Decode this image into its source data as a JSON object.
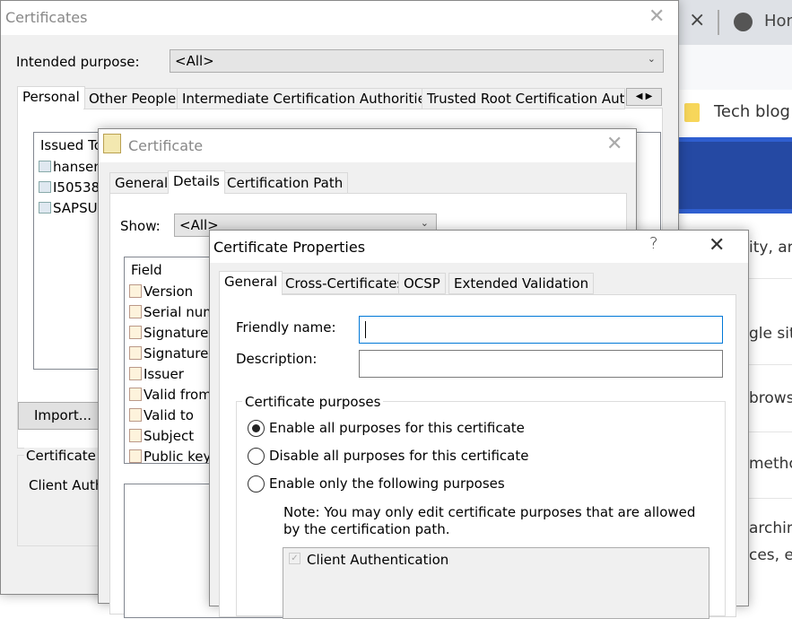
{
  "browser": {
    "tab_close": "×",
    "tab_title": "Hon",
    "bookmark": "Tech blog",
    "fragments": [
      "ity, an",
      "gle sit",
      "browsi",
      "metho",
      "archin",
      "ces, ev"
    ],
    "accent": "#2549a3"
  },
  "certificates": {
    "title": "Certificates",
    "close": "✕",
    "intended_purpose_label": "Intended purpose:",
    "intended_purpose_value": "<All>",
    "tabs": [
      "Personal",
      "Other People",
      "Intermediate Certification Authorities",
      "Trusted Root Certification Auth"
    ],
    "list_header": "Issued To",
    "rows": [
      "hansen",
      "I50538",
      "SAPSU"
    ],
    "import_button": "Import...",
    "group_label": "Certificate in",
    "group_value": "Client Auth"
  },
  "certificate": {
    "title": "Certificate",
    "close": "✕",
    "tabs": [
      "General",
      "Details",
      "Certification Path"
    ],
    "show_label": "Show:",
    "show_value": "<All>",
    "field_header": "Field",
    "fields": [
      "Version",
      "Serial num",
      "Signature",
      "Signature",
      "Issuer",
      "Valid from",
      "Valid to",
      "Subject",
      "Public key"
    ]
  },
  "properties": {
    "title": "Certificate Properties",
    "help": "?",
    "close": "✕",
    "tabs": [
      "General",
      "Cross-Certificates",
      "OCSP",
      "Extended Validation"
    ],
    "friendly_name_label": "Friendly name:",
    "friendly_name_value": "",
    "description_label": "Description:",
    "description_value": "",
    "purposes_group": "Certificate purposes",
    "radios": [
      "Enable all purposes for this certificate",
      "Disable all purposes for this certificate",
      "Enable only the following purposes"
    ],
    "selected_radio": 0,
    "note": "Note: You may only edit certificate purposes that are allowed by the certification path.",
    "purposes": [
      {
        "label": "Client Authentication",
        "checked": true,
        "disabled": true
      }
    ]
  }
}
